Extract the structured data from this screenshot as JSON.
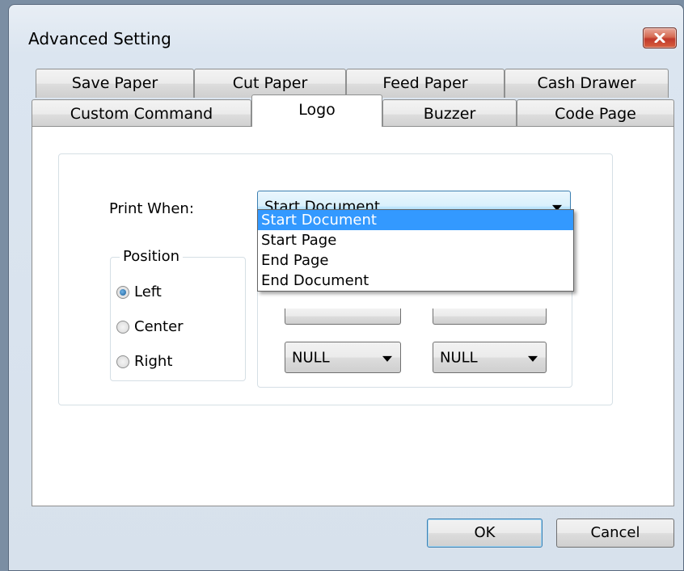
{
  "window": {
    "title": "Advanced Setting"
  },
  "tabs": {
    "row_back": [
      "Save Paper",
      "Cut Paper",
      "Feed Paper",
      "Cash Drawer"
    ],
    "row_front": [
      "Custom Command",
      "Logo",
      "Buzzer",
      "Code Page"
    ],
    "active": "Logo"
  },
  "logo": {
    "print_when_label": "Print When:",
    "print_when_value": "Start Document",
    "print_when_options": [
      "Start Document",
      "Start Page",
      "End Page",
      "End Document"
    ],
    "position_legend": "Position",
    "position_options": [
      "Left",
      "Center",
      "Right"
    ],
    "position_selected": "Left",
    "null_combo_1": "NULL",
    "null_combo_2": "NULL"
  },
  "buttons": {
    "ok": "OK",
    "cancel": "Cancel"
  },
  "colors": {
    "selection": "#3399ff",
    "close_button": "#c0392b"
  }
}
